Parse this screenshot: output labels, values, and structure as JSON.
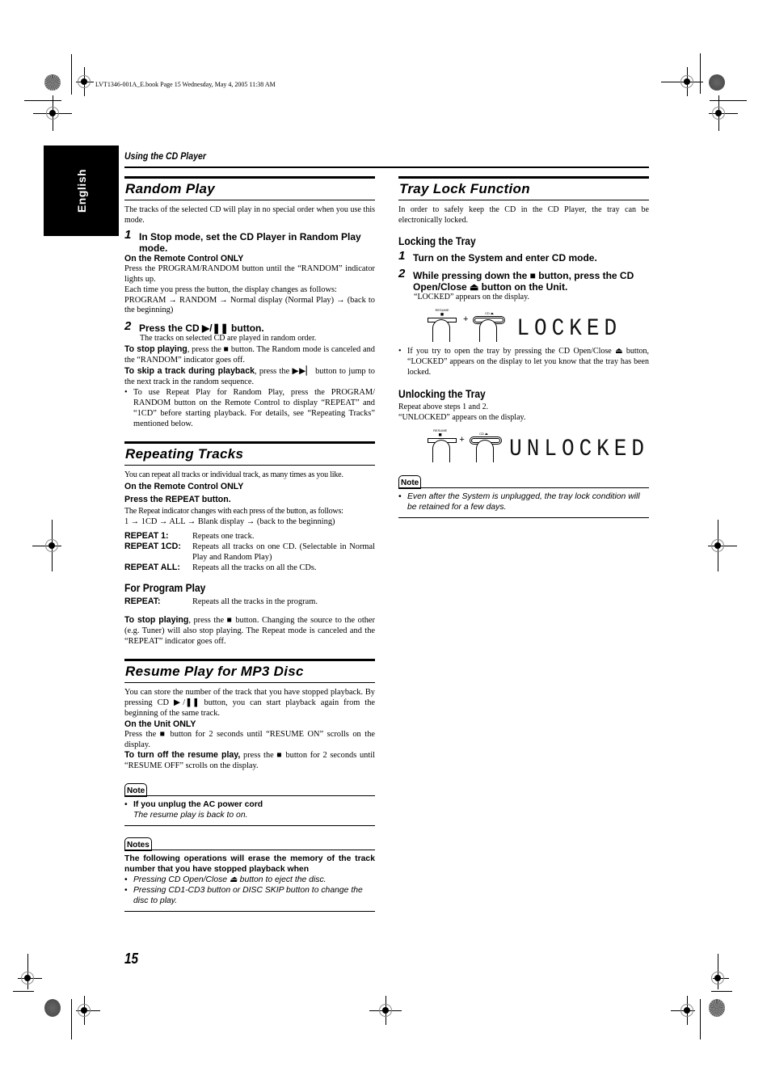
{
  "book_info": "LVT1346-001A_E.book  Page 15  Wednesday, May 4, 2005  11:38 AM",
  "language_tab": "English",
  "section_header": "Using the CD Player",
  "page_number": "15",
  "random_play": {
    "title": "Random Play",
    "intro": "The tracks of the selected CD will play in no special order when you use this mode.",
    "step1": {
      "num": "1",
      "text": "In Stop mode, set the CD Player in Random Play mode."
    },
    "remote_only": "On the Remote Control ONLY",
    "press_text": "Press the PROGRAM/RANDOM button until the “RANDOM” indicator lights up.",
    "each_time": "Each time you press the button, the display changes as follows:",
    "sequence": "PROGRAM → RANDOM → Normal display (Normal Play) → (back to the beginning)",
    "step2": {
      "num": "2",
      "text": "Press the CD ▶/❚❚ button."
    },
    "step2_desc": "The tracks on selected CD are played in random order.",
    "stop_label": "To stop playing",
    "stop_text": ", press the ■ button. The Random mode is canceled and the “RANDOM” indicator goes off.",
    "skip_label": "To skip a track during playback",
    "skip_text": ", press the ▶▶▏ button to jump to the next track in the random sequence.",
    "bullet": "To use Repeat Play for Random Play, press the PROGRAM/ RANDOM button on the Remote Control to display “REPEAT” and “1CD” before starting playback. For details, see “Repeating Tracks” mentioned below."
  },
  "repeating_tracks": {
    "title": "Repeating Tracks",
    "intro": "You can repeat all tracks or individual track, as many times as you like.",
    "remote_only": "On the Remote Control ONLY",
    "press_repeat": "Press the REPEAT button.",
    "changes": "The Repeat indicator changes with each press of the button, as follows:",
    "sequence": "1 → 1CD → ALL → Blank display → (back to the beginning)",
    "modes": [
      {
        "term": "REPEAT 1:",
        "desc": "Repeats one track."
      },
      {
        "term": "REPEAT 1CD:",
        "desc": "Repeats all tracks on one CD. (Selectable in Normal Play and Random Play)"
      },
      {
        "term": "REPEAT ALL:",
        "desc": "Repeats all the tracks on all the CDs."
      }
    ],
    "program_play_heading": "For Program Play",
    "program_mode": {
      "term": "REPEAT:",
      "desc": "Repeats all the tracks in the program."
    },
    "stop_label": "To stop playing",
    "stop_text": ", press the ■ button. Changing the source to the other (e.g. Tuner) will also stop playing. The Repeat mode is canceled and the “REPEAT” indicator goes off."
  },
  "resume_play": {
    "title": "Resume Play for MP3 Disc",
    "intro": "You can store the number of the track that you have stopped playback. By pressing CD ▶/❚❚ button, you can start playback again from the beginning of the same track.",
    "unit_only": "On the Unit ONLY",
    "press_text": "Press the ■ button for 2 seconds until “RESUME ON” scrolls on the display.",
    "turn_off_label": "To turn off the resume play,",
    "turn_off_text": " press the ■ button for 2 seconds until “RESUME OFF” scrolls on the display.",
    "note": {
      "icon_label": "Note",
      "bullet_bold": "If you unplug the AC power cord",
      "bullet_italic": "The resume play is back to on."
    },
    "notes": {
      "icon_label": "Notes",
      "heading": "The following operations will erase the memory of the track number that you have stopped playback when",
      "items": [
        "Pressing CD Open/Close ⏏ button to eject the disc.",
        "Pressing CD1-CD3 button or DISC SKIP button to change the disc to play."
      ]
    }
  },
  "tray_lock": {
    "title": "Tray Lock Function",
    "intro": "In order to safely keep the CD in the CD Player, the tray can be electronically locked.",
    "locking_heading": "Locking the Tray",
    "step1": {
      "num": "1",
      "text": "Turn on the System and enter CD mode."
    },
    "step2": {
      "num": "2",
      "text": "While pressing down the ■ button, press the CD Open/Close ⏏ button on the Unit."
    },
    "locked_appears": "“LOCKED” appears on the display.",
    "figure_locked": {
      "btn1_label": "RESUME",
      "btn1_symbol": "■",
      "btn2_label": "CD ⏏",
      "plus": "+",
      "display": "LOCKED"
    },
    "bullet": "If you try to open the tray by pressing the CD Open/Close ⏏ button, “LOCKED” appears on the display to let you know that the tray has been locked.",
    "unlocking_heading": "Unlocking the Tray",
    "repeat_steps": "Repeat above steps 1 and 2.",
    "unlocked_appears": "“UNLOCKED” appears on the display.",
    "figure_unlocked": {
      "btn1_label": "RESUME",
      "btn1_symbol": "■",
      "btn2_label": "CD ⏏",
      "plus": "+",
      "display": "UNLOCKED"
    },
    "note": {
      "icon_label": "Note",
      "text": "Even after the System is unplugged, the tray lock condition will be retained for a few days."
    }
  }
}
